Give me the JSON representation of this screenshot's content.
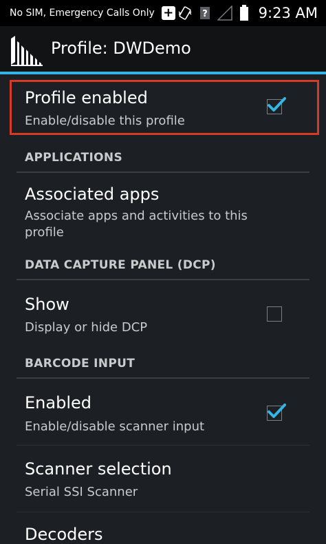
{
  "status_bar": {
    "carrier_text": "No SIM, Emergency Calls Only",
    "time": "9:23 AM"
  },
  "action_bar": {
    "title": "Profile: DWDemo",
    "icon": "barcode-app-icon"
  },
  "colors": {
    "accent": "#33b5e5",
    "highlight": "#d73b24"
  },
  "preferences": {
    "profile_enabled": {
      "title": "Profile enabled",
      "summary": "Enable/disable this profile",
      "checked": true
    },
    "applications_header": "APPLICATIONS",
    "associated_apps": {
      "title": "Associated apps",
      "summary": "Associate apps and activities to this profile"
    },
    "dcp_header": "DATA CAPTURE PANEL (DCP)",
    "show": {
      "title": "Show",
      "summary": "Display or hide DCP",
      "checked": false
    },
    "barcode_header": "BARCODE INPUT",
    "enabled": {
      "title": "Enabled",
      "summary": "Enable/disable scanner input",
      "checked": true
    },
    "scanner_selection": {
      "title": "Scanner selection",
      "summary": "Serial SSI Scanner"
    },
    "decoders": {
      "title": "Decoders"
    }
  }
}
